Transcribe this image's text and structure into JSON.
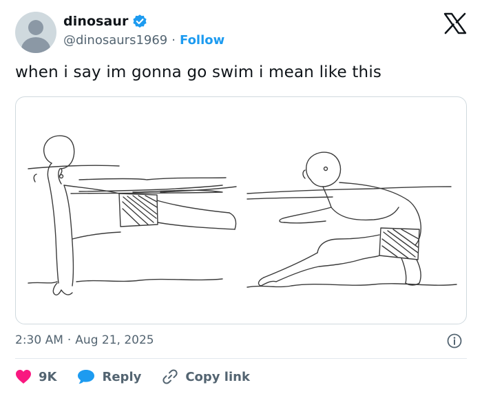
{
  "author": {
    "display_name": "dinosaur",
    "handle": "@dinosaurs1969",
    "separator": "·",
    "follow_label": "Follow",
    "verified": true
  },
  "tweet": {
    "text": "when i say im gonna go swim i mean like this",
    "time": "2:30 AM",
    "separator": "·",
    "date": "Aug 21, 2025"
  },
  "actions": {
    "like_count": "9K",
    "reply_label": "Reply",
    "copy_link_label": "Copy link"
  },
  "icons": {
    "brand": "x-logo-icon",
    "verified": "verified-badge-icon",
    "like": "heart-icon",
    "reply": "speech-bubble-icon",
    "copy": "link-icon",
    "info": "info-icon"
  },
  "colors": {
    "accent": "#1d9bf0",
    "like": "#f91880",
    "text": "#0f1419",
    "secondary": "#536471",
    "avatar_bg": "#cfd9de"
  }
}
